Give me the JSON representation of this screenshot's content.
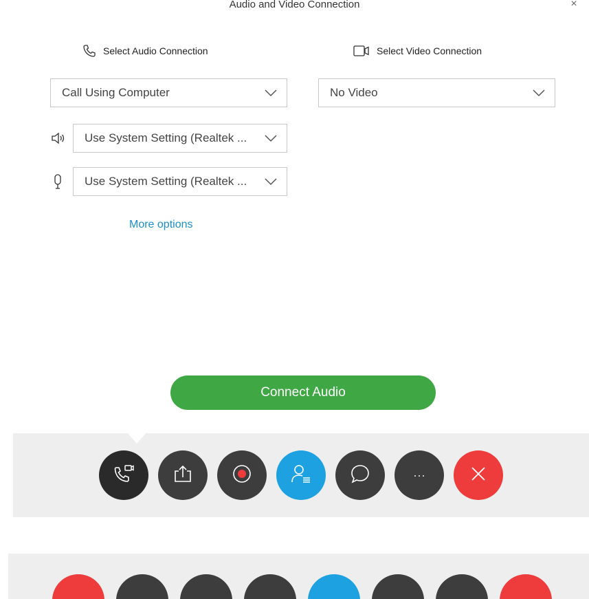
{
  "dialog": {
    "title": "Audio and Video Connection",
    "close_label": "×"
  },
  "audio": {
    "heading": "Select Audio Connection",
    "connection_value": "Call Using Computer",
    "speaker_value": "Use System Setting (Realtek ...",
    "microphone_value": "Use System Setting (Realtek ...",
    "more_options_label": "More options"
  },
  "video": {
    "heading": "Select Video Connection",
    "connection_value": "No Video"
  },
  "connect_button_label": "Connect Audio",
  "colors": {
    "accent_blue": "#1a8fc7",
    "connect_green": "#3fa844",
    "toolbar_dark": "#3d3d3d",
    "toolbar_active": "#2a2a2a",
    "participants_blue": "#1da1e0",
    "end_red": "#ee3b3b"
  },
  "toolbar": {
    "buttons": [
      {
        "name": "audio-video-connection",
        "icon": "phone-video-icon",
        "active": true
      },
      {
        "name": "share",
        "icon": "share-icon"
      },
      {
        "name": "record",
        "icon": "record-icon"
      },
      {
        "name": "participants",
        "icon": "participants-icon"
      },
      {
        "name": "chat",
        "icon": "chat-icon"
      },
      {
        "name": "more",
        "icon": "more-icon",
        "glyph": "···"
      },
      {
        "name": "end-meeting",
        "icon": "close-icon"
      }
    ]
  }
}
